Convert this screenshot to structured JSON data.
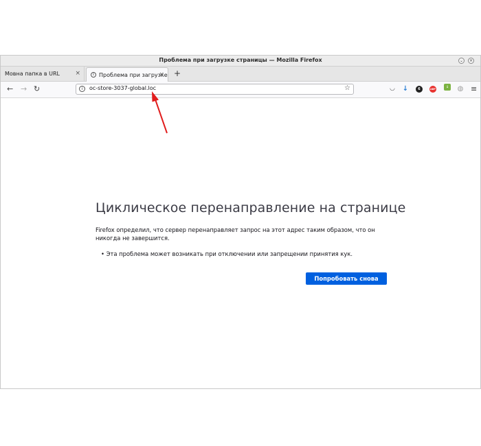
{
  "window": {
    "title": "Проблема при загрузке страницы — Mozilla Firefox",
    "controls": {
      "minimize": "⌄",
      "close": "×"
    }
  },
  "tabs": [
    {
      "label": "Мовна папка в URL",
      "active": false,
      "close": "×"
    },
    {
      "label": "Проблема при загрузке",
      "active": true,
      "close": "×"
    }
  ],
  "new_tab_label": "+",
  "navbar": {
    "back": "←",
    "forward": "→",
    "reload": "↻",
    "url": "oc-store-3037-global.loc",
    "info_icon": "i",
    "bookmark_star": "☆",
    "menu": "≡"
  },
  "toolbar_icons": [
    {
      "name": "pocket-icon",
      "glyph": "◡",
      "color": "#555555"
    },
    {
      "name": "download-icon",
      "glyph": "↓",
      "color": "#2a7fd4"
    },
    {
      "name": "extension-dark-icon",
      "glyph": "6",
      "color": "#222222"
    },
    {
      "name": "adblock-icon",
      "glyph": "ABP",
      "color": "#e8322f"
    },
    {
      "name": "extension-download-icon",
      "glyph": "↓",
      "color": "#7cb342"
    },
    {
      "name": "extension-globe-icon",
      "glyph": "◍",
      "color": "#9e9e9e"
    }
  ],
  "error": {
    "title": "Циклическое перенаправление на странице",
    "description": "Firefox определил, что сервер перенаправляет запрос на этот адрес таким образом, что он никогда не завершится.",
    "bullet": "Эта проблема может возникать при отключении или запрещении принятия кук.",
    "button": "Попробовать снова"
  },
  "colors": {
    "accent": "#0060df",
    "annotation_arrow": "#e11d1d"
  }
}
